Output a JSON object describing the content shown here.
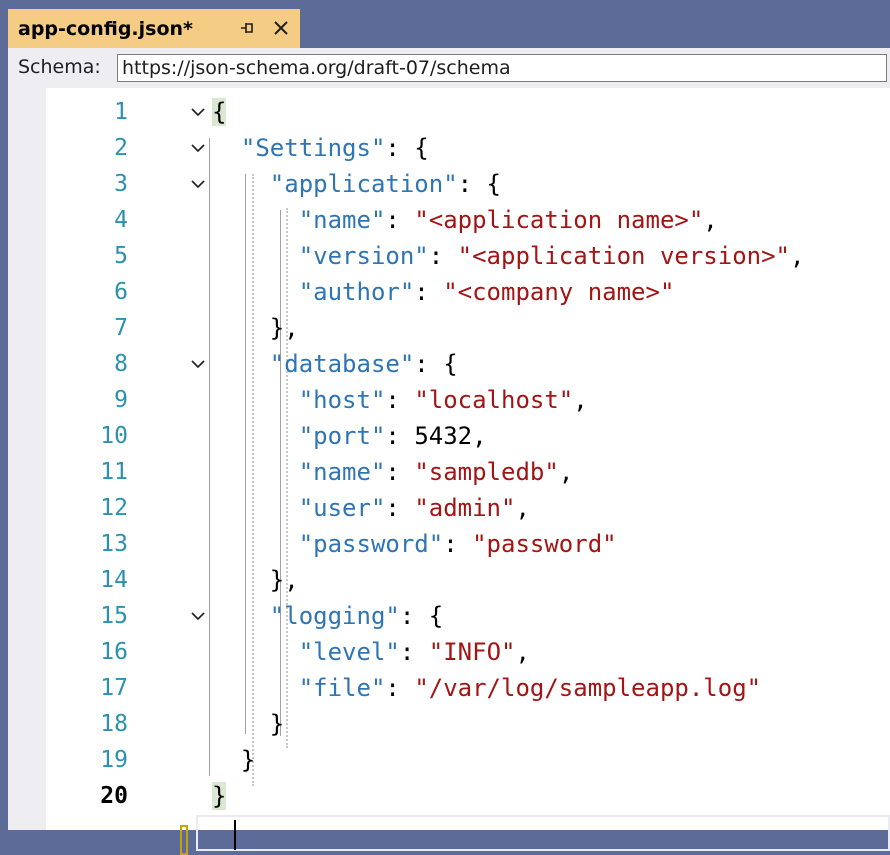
{
  "tab": {
    "title": "app-config.json*",
    "pin_icon": "pin-icon",
    "close_icon": "close-icon"
  },
  "schema": {
    "label": "Schema:",
    "value": "https://json-schema.org/draft-07/schema"
  },
  "editor": {
    "current_line": 20,
    "lines": [
      {
        "num": "1",
        "fold": true
      },
      {
        "num": "2",
        "fold": true
      },
      {
        "num": "3",
        "fold": true
      },
      {
        "num": "4",
        "fold": false
      },
      {
        "num": "5",
        "fold": false
      },
      {
        "num": "6",
        "fold": false
      },
      {
        "num": "7",
        "fold": false
      },
      {
        "num": "8",
        "fold": true
      },
      {
        "num": "9",
        "fold": false
      },
      {
        "num": "10",
        "fold": false
      },
      {
        "num": "11",
        "fold": false
      },
      {
        "num": "12",
        "fold": false
      },
      {
        "num": "13",
        "fold": false
      },
      {
        "num": "14",
        "fold": false
      },
      {
        "num": "15",
        "fold": true
      },
      {
        "num": "16",
        "fold": false
      },
      {
        "num": "17",
        "fold": false
      },
      {
        "num": "18",
        "fold": false
      },
      {
        "num": "19",
        "fold": false
      },
      {
        "num": "20",
        "fold": false
      }
    ],
    "code": [
      [
        {
          "t": "p",
          "v": "{"
        }
      ],
      [
        {
          "t": "p",
          "v": "  "
        },
        {
          "t": "k",
          "v": "\"Settings\""
        },
        {
          "t": "p",
          "v": ": {"
        }
      ],
      [
        {
          "t": "p",
          "v": "    "
        },
        {
          "t": "k",
          "v": "\"application\""
        },
        {
          "t": "p",
          "v": ": {"
        }
      ],
      [
        {
          "t": "p",
          "v": "      "
        },
        {
          "t": "k",
          "v": "\"name\""
        },
        {
          "t": "p",
          "v": ": "
        },
        {
          "t": "s",
          "v": "\"<application name>\""
        },
        {
          "t": "p",
          "v": ","
        }
      ],
      [
        {
          "t": "p",
          "v": "      "
        },
        {
          "t": "k",
          "v": "\"version\""
        },
        {
          "t": "p",
          "v": ": "
        },
        {
          "t": "s",
          "v": "\"<application version>\""
        },
        {
          "t": "p",
          "v": ","
        }
      ],
      [
        {
          "t": "p",
          "v": "      "
        },
        {
          "t": "k",
          "v": "\"author\""
        },
        {
          "t": "p",
          "v": ": "
        },
        {
          "t": "s",
          "v": "\"<company name>\""
        }
      ],
      [
        {
          "t": "p",
          "v": "    },"
        }
      ],
      [
        {
          "t": "p",
          "v": "    "
        },
        {
          "t": "k",
          "v": "\"database\""
        },
        {
          "t": "p",
          "v": ": {"
        }
      ],
      [
        {
          "t": "p",
          "v": "      "
        },
        {
          "t": "k",
          "v": "\"host\""
        },
        {
          "t": "p",
          "v": ": "
        },
        {
          "t": "s",
          "v": "\"localhost\""
        },
        {
          "t": "p",
          "v": ","
        }
      ],
      [
        {
          "t": "p",
          "v": "      "
        },
        {
          "t": "k",
          "v": "\"port\""
        },
        {
          "t": "p",
          "v": ": "
        },
        {
          "t": "n",
          "v": "5432"
        },
        {
          "t": "p",
          "v": ","
        }
      ],
      [
        {
          "t": "p",
          "v": "      "
        },
        {
          "t": "k",
          "v": "\"name\""
        },
        {
          "t": "p",
          "v": ": "
        },
        {
          "t": "s",
          "v": "\"sampledb\""
        },
        {
          "t": "p",
          "v": ","
        }
      ],
      [
        {
          "t": "p",
          "v": "      "
        },
        {
          "t": "k",
          "v": "\"user\""
        },
        {
          "t": "p",
          "v": ": "
        },
        {
          "t": "s",
          "v": "\"admin\""
        },
        {
          "t": "p",
          "v": ","
        }
      ],
      [
        {
          "t": "p",
          "v": "      "
        },
        {
          "t": "k",
          "v": "\"password\""
        },
        {
          "t": "p",
          "v": ": "
        },
        {
          "t": "s",
          "v": "\"password\""
        }
      ],
      [
        {
          "t": "p",
          "v": "    },"
        }
      ],
      [
        {
          "t": "p",
          "v": "    "
        },
        {
          "t": "k",
          "v": "\"logging\""
        },
        {
          "t": "p",
          "v": ": {"
        }
      ],
      [
        {
          "t": "p",
          "v": "      "
        },
        {
          "t": "k",
          "v": "\"level\""
        },
        {
          "t": "p",
          "v": ": "
        },
        {
          "t": "s",
          "v": "\"INFO\""
        },
        {
          "t": "p",
          "v": ","
        }
      ],
      [
        {
          "t": "p",
          "v": "      "
        },
        {
          "t": "k",
          "v": "\"file\""
        },
        {
          "t": "p",
          "v": ": "
        },
        {
          "t": "s",
          "v": "\"/var/log/sampleapp.log\""
        }
      ],
      [
        {
          "t": "p",
          "v": "    }"
        }
      ],
      [
        {
          "t": "p",
          "v": "  }"
        }
      ],
      [
        {
          "t": "p",
          "v": "}"
        }
      ]
    ]
  },
  "colors": {
    "tab_active": "#f5cc84",
    "frame": "#5d6b99",
    "key": "#2e75b6",
    "string": "#a31515",
    "line_number": "#2b91af"
  }
}
